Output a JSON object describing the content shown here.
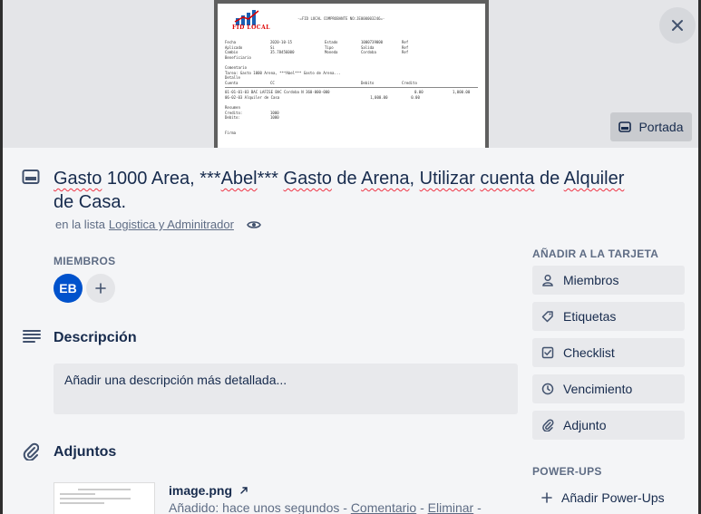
{
  "cover": {
    "doc_header": "-=FID LOCAL COMPROBANTE NO:JE000003246=-",
    "logo_text": "FID LOCAL",
    "doc_rows": [
      [
        "Fecha",
        "2020-10-15",
        "Estado",
        "1000739000",
        "Ref"
      ],
      [
        "Aplicado",
        "Si",
        "Tipo",
        "Salida",
        "Ref"
      ],
      [
        "Cambio",
        "35.78456000",
        "Moneda",
        "Cordoba",
        "Ref"
      ],
      [
        "Beneficiario",
        "",
        "",
        "",
        ""
      ],
      [
        "",
        "",
        "",
        "",
        ""
      ],
      [
        "Comentario",
        "",
        "",
        "",
        ""
      ],
      [
        "Tarea: Gasto 1000 Arena, ***Abel*** Gasto de Arena...",
        "",
        "",
        "",
        ""
      ],
      [
        "Detalle",
        "",
        "",
        "",
        ""
      ],
      [
        "Cuenta",
        "CC",
        "",
        "Debito",
        "Credito"
      ],
      [
        "01-01-01-03 BAC LAFISE BAC Cordoba N 360-000-000",
        "",
        "",
        "0.00",
        "1,000.00"
      ],
      [
        "06-02-03 Alquiler de Casa",
        "",
        "",
        "1,000.00",
        "0.00"
      ],
      [
        "",
        "",
        "",
        "",
        ""
      ],
      [
        "Resumen",
        "",
        "",
        "",
        ""
      ],
      [
        "Credito:",
        "1000",
        "",
        "",
        ""
      ],
      [
        "Debito:",
        "1000",
        "",
        "",
        ""
      ],
      [
        "",
        "",
        "",
        "",
        ""
      ],
      [
        "",
        "",
        "",
        "",
        ""
      ],
      [
        "Firma",
        "",
        "",
        "",
        ""
      ]
    ],
    "cover_button_label": "Portada"
  },
  "card": {
    "title_parts": [
      "Gasto",
      " 1000 Area, ***",
      "Abel",
      "*** ",
      "Gasto",
      " de ",
      "Arena",
      ", ",
      "Utilizar",
      " ",
      "cuenta",
      " de ",
      "Alquiler",
      " de Casa."
    ],
    "list_prefix": "en la lista",
    "list_name": "Logistica y Adminitrador"
  },
  "members": {
    "label": "MIEMBROS",
    "avatar_initials": "EB"
  },
  "description": {
    "heading": "Descripción",
    "placeholder": "Añadir una descripción más detallada..."
  },
  "attachments": {
    "heading": "Adjuntos",
    "file_name": "image.png",
    "added_text": "Añadido: hace unos segundos - ",
    "comment_link": "Comentario",
    "separator": " - ",
    "delete_link": "Eliminar",
    "trailing": " -"
  },
  "sidebar": {
    "add_label": "AÑADIR A LA TARJETA",
    "buttons": [
      {
        "label": "Miembros",
        "icon": "person-icon"
      },
      {
        "label": "Etiquetas",
        "icon": "tag-icon"
      },
      {
        "label": "Checklist",
        "icon": "checkbox-icon"
      },
      {
        "label": "Vencimiento",
        "icon": "clock-icon"
      },
      {
        "label": "Adjunto",
        "icon": "paperclip-icon"
      }
    ],
    "powerups_label": "POWER-UPS",
    "add_powerups": "Añadir Power-Ups"
  }
}
